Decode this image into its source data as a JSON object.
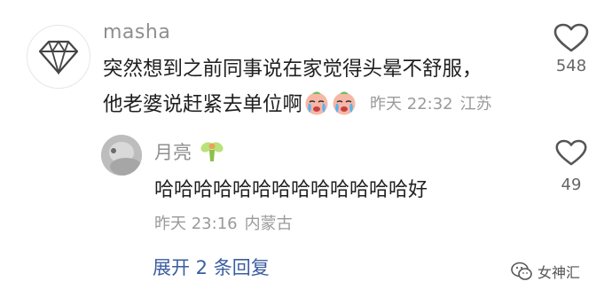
{
  "comment": {
    "username": "masha",
    "text_line1": "突然想到之前同事说在家觉得头晕不舒服，",
    "text_line2": "他老婆说赶紧去单位啊",
    "emoji_icons": [
      "crying-face-icon",
      "crying-face-icon"
    ],
    "time": "昨天 22:32",
    "location": "江苏",
    "likes": "548"
  },
  "reply": {
    "username": "月亮",
    "badge_icon": "fairy-icon",
    "text": "哈哈哈哈哈哈哈哈哈哈哈哈哈好",
    "time": "昨天 23:16",
    "location": "内蒙古",
    "likes": "49"
  },
  "expand_replies": "展开 2 条回复",
  "watermark": {
    "text": "女神汇",
    "icon": "wechat-icon"
  },
  "colors": {
    "username": "#8f8f8f",
    "text": "#1f1f1f",
    "meta": "#9a9a9a",
    "link": "#3b5da0"
  }
}
